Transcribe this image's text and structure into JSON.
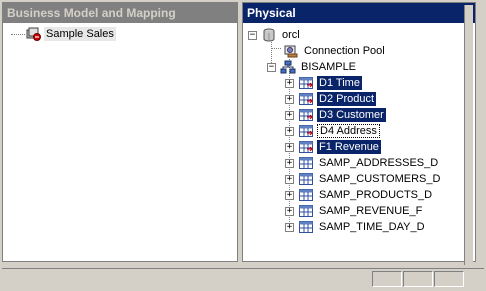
{
  "left_pane": {
    "title": "Business Model and Mapping",
    "items": [
      {
        "label": "Sample Sales",
        "icon": "business-model-icon"
      }
    ]
  },
  "right_pane": {
    "title": "Physical",
    "root": {
      "label": "orcl",
      "icon": "database-icon",
      "expanded": true
    },
    "connection_pool": {
      "label": "Connection Pool",
      "icon": "connection-pool-icon"
    },
    "schema": {
      "label": "BISAMPLE",
      "icon": "schema-icon",
      "expanded": true
    },
    "tables": [
      {
        "label": "D1 Time",
        "selected": true
      },
      {
        "label": "D2 Product",
        "selected": true
      },
      {
        "label": "D3 Customer",
        "selected": true
      },
      {
        "label": "D4 Address",
        "selected": false,
        "focused": true
      },
      {
        "label": "F1 Revenue",
        "selected": true
      },
      {
        "label": "SAMP_ADDRESSES_D",
        "selected": false
      },
      {
        "label": "SAMP_CUSTOMERS_D",
        "selected": false
      },
      {
        "label": "SAMP_PRODUCTS_D",
        "selected": false
      },
      {
        "label": "SAMP_REVENUE_F",
        "selected": false
      },
      {
        "label": "SAMP_TIME_DAY_D",
        "selected": false
      }
    ]
  },
  "colors": {
    "selection": "#0a246a",
    "panel": "#d4d0c8"
  }
}
